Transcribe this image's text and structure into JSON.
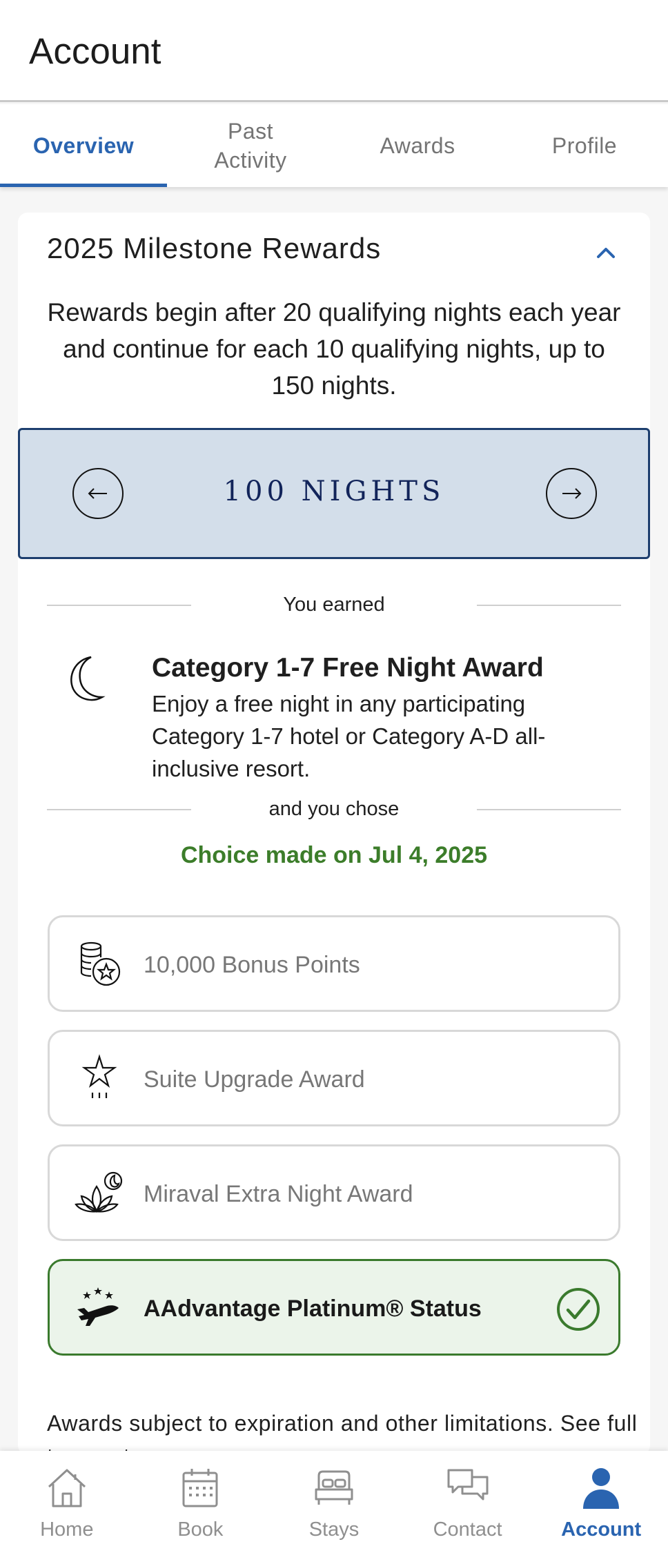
{
  "header": {
    "title": "Account"
  },
  "tabs": [
    {
      "label": "Overview",
      "active": true
    },
    {
      "label": "Past Activity",
      "active": false
    },
    {
      "label": "Awards",
      "active": false
    },
    {
      "label": "Profile",
      "active": false
    }
  ],
  "milestone": {
    "title": "2025 Milestone Rewards",
    "intro": "Rewards begin after 20 qualifying nights each year and continue for each 10 qualifying nights, up to 150 nights.",
    "nights_label": "100 NIGHTS",
    "you_earned": "You earned",
    "earned_title": "Category 1-7 Free Night Award",
    "earned_desc": "Enjoy a free night in any participating Category 1-7 hotel or Category A-D all-inclusive resort.",
    "and_you_chose": "and you chose",
    "choice_date": "Choice made on Jul 4, 2025",
    "options": [
      {
        "label": "10,000 Bonus Points",
        "icon": "coins-star-icon",
        "selected": false
      },
      {
        "label": "Suite Upgrade Award",
        "icon": "star-icon",
        "selected": false
      },
      {
        "label": "Miraval Extra Night Award",
        "icon": "lotus-moon-icon",
        "selected": false
      },
      {
        "label": "AAdvantage Platinum® Status",
        "icon": "airplane-stars-icon",
        "selected": true
      }
    ],
    "footnote": "Awards subject to expiration and other limitations. See full terms at"
  },
  "bottom_nav": [
    {
      "label": "Home",
      "icon": "home-icon",
      "active": false
    },
    {
      "label": "Book",
      "icon": "calendar-icon",
      "active": false
    },
    {
      "label": "Stays",
      "icon": "bed-icon",
      "active": false
    },
    {
      "label": "Contact",
      "icon": "chat-icon",
      "active": false
    },
    {
      "label": "Account",
      "icon": "person-icon",
      "active": true
    }
  ],
  "colors": {
    "accent_blue": "#2a64b0",
    "nights_box_bg": "#d3deea",
    "nights_text": "#12245a",
    "selected_green": "#3a7a2d",
    "choice_green": "#3c7d2a"
  }
}
